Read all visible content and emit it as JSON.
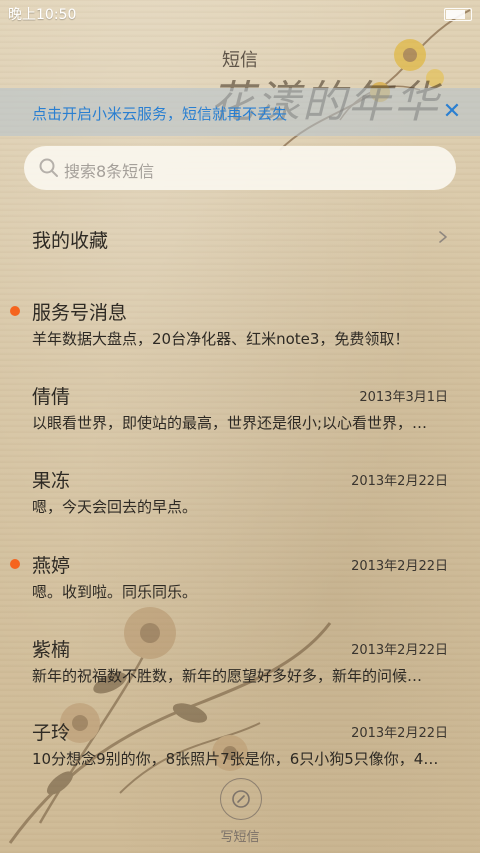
{
  "status_bar": {
    "time": "晚上10:50"
  },
  "header": {
    "title": "短信",
    "watermark": "花漾的年华"
  },
  "banner": {
    "text": "点击开启小米云服务，短信就再不丢失",
    "close_icon": "close-icon"
  },
  "search": {
    "placeholder": "搜索8条短信",
    "icon": "search-icon"
  },
  "collection": {
    "label": "我的收藏",
    "icon": "chevron-right-icon"
  },
  "threads": [
    {
      "name": "服务号消息",
      "date": "",
      "snippet": "羊年数据大盘点，20台净化器、红米note3，免费领取！",
      "unread": true
    },
    {
      "name": "倩倩",
      "date": "2013年3月1日",
      "snippet": "以眼看世界，即使站的最高，世界还是很小;以心看世界，…",
      "unread": false
    },
    {
      "name": "果冻",
      "date": "2013年2月22日",
      "snippet": "嗯，今天会回去的早点。",
      "unread": false
    },
    {
      "name": "燕婷",
      "date": "2013年2月22日",
      "snippet": "嗯。收到啦。同乐同乐。",
      "unread": true
    },
    {
      "name": "紫楠",
      "date": "2013年2月22日",
      "snippet": "新年的祝福数不胜数，新年的愿望好多好多，新年的问候…",
      "unread": false
    },
    {
      "name": "子玲",
      "date": "2013年2月22日",
      "snippet": "10分想念9别的你，8张照片7张是你，6只小狗5只像你，4…",
      "unread": false
    }
  ],
  "compose": {
    "label": "写短信",
    "icon": "compose-icon"
  },
  "colors": {
    "accent": "#2a7fd1",
    "unread_dot": "#f5641e",
    "text": "#2e2a24"
  }
}
